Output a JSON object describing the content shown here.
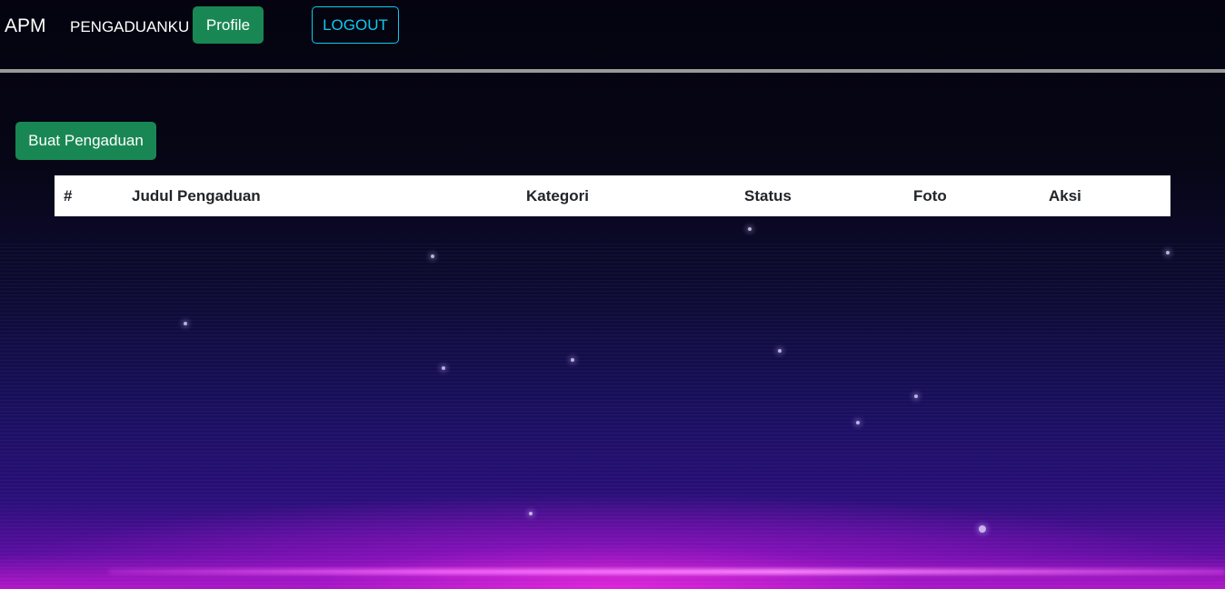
{
  "navbar": {
    "brand": "APM",
    "nav_link": "PENGADUANKU",
    "profile_button": "Profile",
    "logout_button": "LOGOUT"
  },
  "main": {
    "create_button": "Buat Pengaduan",
    "table": {
      "headers": [
        "#",
        "Judul Pengaduan",
        "Kategori",
        "Status",
        "Foto",
        "Aksi"
      ],
      "rows": []
    }
  },
  "colors": {
    "success": "#198754",
    "info": "#0dcaf0",
    "divider": "#9a9a9a",
    "background_top": "#04030f",
    "glow": "#e028dc"
  }
}
